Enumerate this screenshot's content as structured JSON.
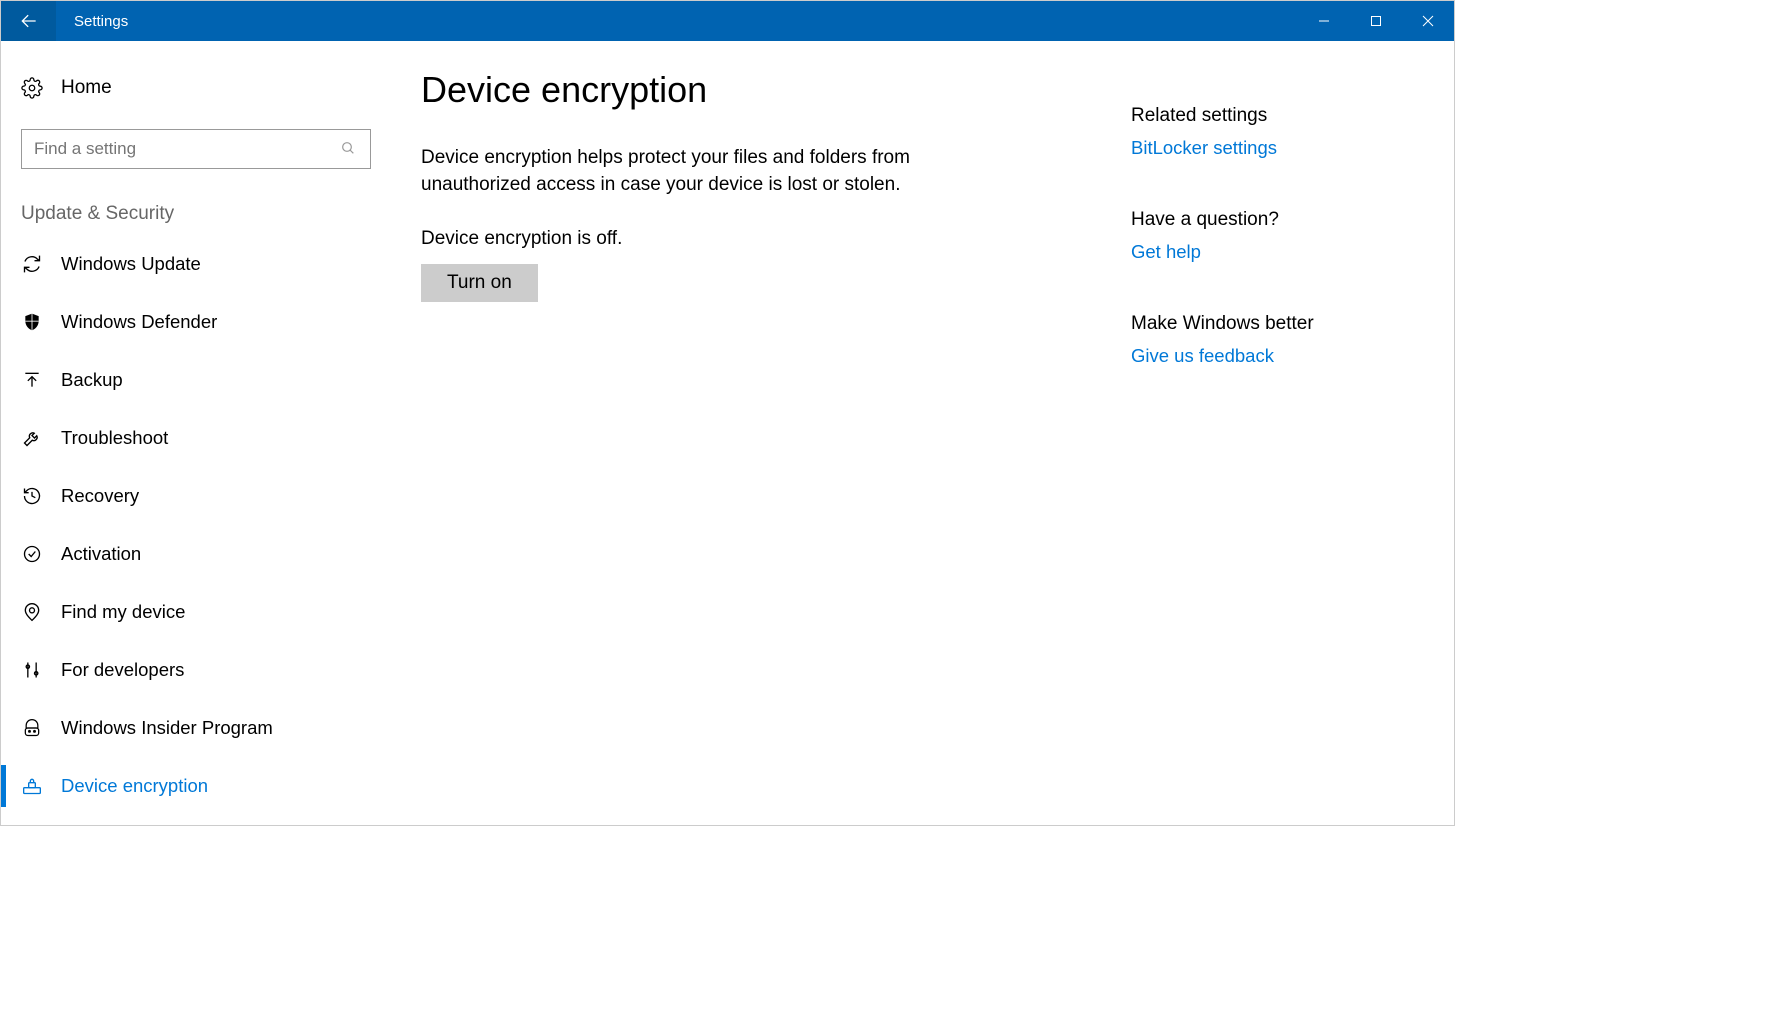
{
  "titlebar": {
    "title": "Settings"
  },
  "sidebar": {
    "home": "Home",
    "search_placeholder": "Find a setting",
    "section": "Update & Security",
    "items": [
      {
        "label": "Windows Update"
      },
      {
        "label": "Windows Defender"
      },
      {
        "label": "Backup"
      },
      {
        "label": "Troubleshoot"
      },
      {
        "label": "Recovery"
      },
      {
        "label": "Activation"
      },
      {
        "label": "Find my device"
      },
      {
        "label": "For developers"
      },
      {
        "label": "Windows Insider Program"
      },
      {
        "label": "Device encryption"
      }
    ]
  },
  "main": {
    "title": "Device encryption",
    "description": "Device encryption helps protect your files and folders from unauthorized access in case your device is lost or stolen.",
    "status": "Device encryption is off.",
    "button": "Turn on"
  },
  "aside": {
    "related_heading": "Related settings",
    "related_link": "BitLocker settings",
    "question_heading": "Have a question?",
    "question_link": "Get help",
    "feedback_heading": "Make Windows better",
    "feedback_link": "Give us feedback"
  }
}
